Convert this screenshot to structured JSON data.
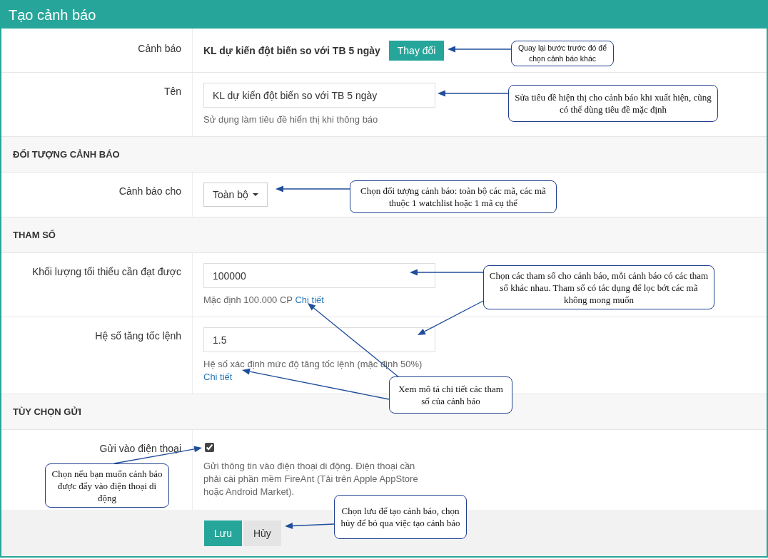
{
  "window": {
    "title": "Tạo cảnh báo"
  },
  "form": [
    {
      "kind": "static",
      "label": "Cảnh báo",
      "value": "KL dự kiến đột biến so với TB 5 ngày",
      "button": "Thay đổi"
    },
    {
      "kind": "text",
      "label": "Tên",
      "value": "KL dự kiến đột biến so với TB 5 ngày",
      "help": "Sử dụng làm tiêu đề hiển thị khi thông báo"
    },
    {
      "kind": "section",
      "heading": "ĐỐI TƯỢNG CẢNH BÁO"
    },
    {
      "kind": "dropdown",
      "label": "Cảnh báo cho",
      "value": "Toàn bộ"
    },
    {
      "kind": "section",
      "heading": "THAM SỐ"
    },
    {
      "kind": "text",
      "label": "Khối lượng tối thiểu cần đạt được",
      "value": "100000",
      "help": "Mặc định 100.000 CP",
      "link": "Chi tiết"
    },
    {
      "kind": "text",
      "label": "Hệ số tăng tốc lệnh",
      "value": "1.5",
      "help": "Hệ số xác định mức độ tăng tốc lệnh (mặc định 50%)",
      "link": "Chi tiết"
    },
    {
      "kind": "section",
      "heading": "TÙY CHỌN GỬI"
    },
    {
      "kind": "checkbox",
      "label": "Gửi vào điện thoại",
      "checked": true,
      "help": "Gửi thông tin vào điện thoại di động. Điện thoại cần phải cài phần mềm FireAnt (Tải trên Apple AppStore hoặc Android Market)."
    }
  ],
  "buttons": [
    {
      "label": "Lưu",
      "kind": "primary"
    },
    {
      "label": "Hủy",
      "kind": "default"
    }
  ],
  "callouts": [
    {
      "text": "Quay lại bước trước đó để chọn cảnh báo khác"
    },
    {
      "text": "Sửa tiêu đề hiện thị cho cảnh báo khi xuất hiện, cũng có thể dùng tiêu đề mặc định"
    },
    {
      "text": "Chọn đối tượng cảnh báo: toàn bộ các mã, các mã thuộc 1 watchlist hoặc 1 mã cụ thể"
    },
    {
      "text": "Chọn các tham số cho cảnh báo, mỗi cảnh báo có các tham số khác nhau. Tham số có tác dụng để lọc bớt các mã không mong muốn"
    },
    {
      "text": "Xem mô tả chi tiết các tham số của cảnh báo"
    },
    {
      "text": "Chọn nếu bạn muốn cảnh báo được đẩy vào điện thoại di động"
    },
    {
      "text": "Chọn lưu để tạo cảnh báo, chọn hủy để bỏ qua việc tạo cảnh báo"
    }
  ]
}
